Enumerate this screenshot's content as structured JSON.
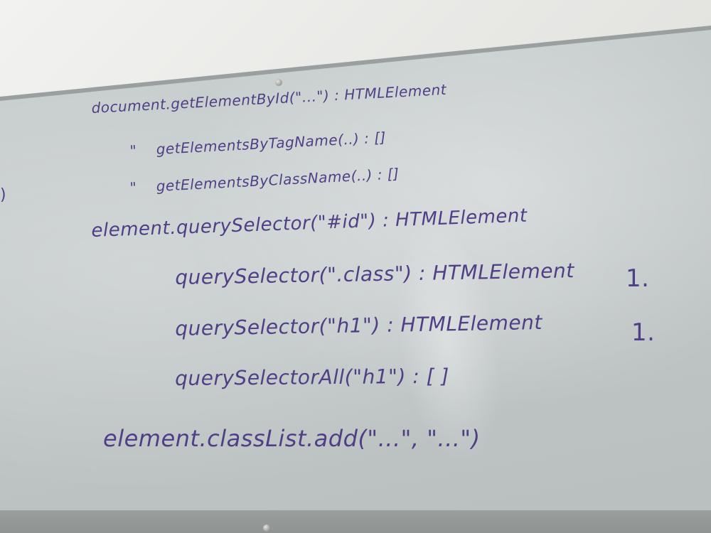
{
  "whiteboard": {
    "lines": [
      "document.getElementById(\"...\") : HTMLElement",
      "\"    getElementsByTagName(..) : []",
      "\"    getElementsByClassName(..) : []",
      "element.querySelector(\"#id\") : HTMLElement",
      "querySelector(\".class\") : HTMLElement",
      "querySelector(\"h1\") : HTMLElement",
      "querySelectorAll(\"h1\") : [ ]",
      "element.classList.add(\"...\", \"...\")"
    ],
    "annotations": [
      "1.",
      "1."
    ],
    "ink_color": "#4e3f86"
  }
}
